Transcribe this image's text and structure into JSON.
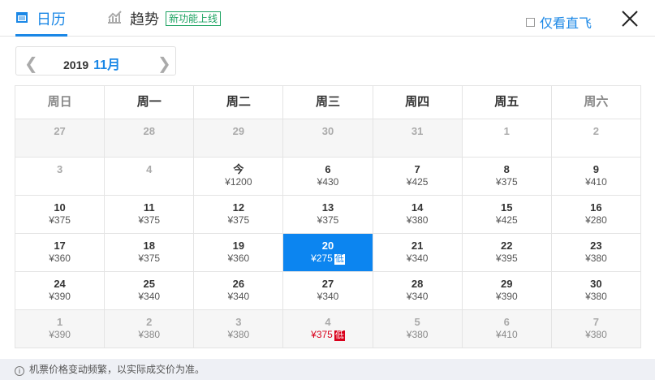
{
  "tabs": {
    "calendar": "日历",
    "trend": "趋势",
    "new_badge": "新功能上线"
  },
  "direct_only": "仅看直飞",
  "month": {
    "year": "2019",
    "month": "11月"
  },
  "weekdays": [
    "周日",
    "周一",
    "周二",
    "周三",
    "周四",
    "周五",
    "周六"
  ],
  "low_label": "低",
  "weeks": [
    [
      {
        "d": "27",
        "t": "other"
      },
      {
        "d": "28",
        "t": "other"
      },
      {
        "d": "29",
        "t": "other"
      },
      {
        "d": "30",
        "t": "other"
      },
      {
        "d": "31",
        "t": "other"
      },
      {
        "d": "1",
        "t": "dis"
      },
      {
        "d": "2",
        "t": "dis"
      }
    ],
    [
      {
        "d": "3",
        "t": "dis"
      },
      {
        "d": "4",
        "t": "dis"
      },
      {
        "d": "今",
        "p": "¥1200"
      },
      {
        "d": "6",
        "p": "¥430"
      },
      {
        "d": "7",
        "p": "¥425"
      },
      {
        "d": "8",
        "p": "¥375"
      },
      {
        "d": "9",
        "p": "¥410"
      }
    ],
    [
      {
        "d": "10",
        "p": "¥375"
      },
      {
        "d": "11",
        "p": "¥375"
      },
      {
        "d": "12",
        "p": "¥375"
      },
      {
        "d": "13",
        "p": "¥375"
      },
      {
        "d": "14",
        "p": "¥380"
      },
      {
        "d": "15",
        "p": "¥425"
      },
      {
        "d": "16",
        "p": "¥280"
      }
    ],
    [
      {
        "d": "17",
        "p": "¥360"
      },
      {
        "d": "18",
        "p": "¥375"
      },
      {
        "d": "19",
        "p": "¥360"
      },
      {
        "d": "20",
        "p": "¥275",
        "t": "sel",
        "low": true
      },
      {
        "d": "21",
        "p": "¥340"
      },
      {
        "d": "22",
        "p": "¥395"
      },
      {
        "d": "23",
        "p": "¥380"
      }
    ],
    [
      {
        "d": "24",
        "p": "¥390"
      },
      {
        "d": "25",
        "p": "¥340"
      },
      {
        "d": "26",
        "p": "¥340"
      },
      {
        "d": "27",
        "p": "¥340"
      },
      {
        "d": "28",
        "p": "¥340"
      },
      {
        "d": "29",
        "p": "¥390"
      },
      {
        "d": "30",
        "p": "¥380"
      }
    ],
    [
      {
        "d": "1",
        "p": "¥390",
        "t": "other"
      },
      {
        "d": "2",
        "p": "¥380",
        "t": "other"
      },
      {
        "d": "3",
        "p": "¥380",
        "t": "other"
      },
      {
        "d": "4",
        "p": "¥375",
        "t": "other lowred",
        "low": true
      },
      {
        "d": "5",
        "p": "¥380",
        "t": "other"
      },
      {
        "d": "6",
        "p": "¥410",
        "t": "other"
      },
      {
        "d": "7",
        "p": "¥380",
        "t": "other"
      }
    ]
  ],
  "footer": "机票价格变动频繁，以实际成交价为准。",
  "colors": {
    "accent": "#0c85f0",
    "low_red": "#d9001b",
    "badge_green": "#1aa260"
  }
}
